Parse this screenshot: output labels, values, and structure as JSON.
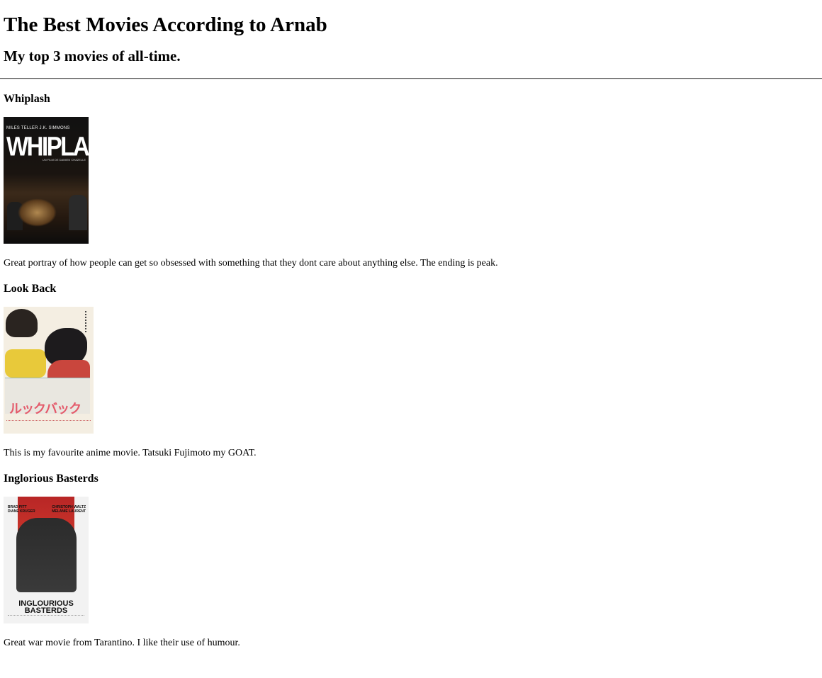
{
  "page": {
    "title": "The Best Movies According to Arnab",
    "subtitle": "My top 3 movies of all-time."
  },
  "movies": [
    {
      "title": "Whiplash",
      "review": "Great portray of how people can get so obsessed with something that they dont care about anything else. The ending is peak.",
      "poster": {
        "cast_text": "MILES TELLER  J.K. SIMMONS",
        "title_text": "WHIPLASH",
        "credit_text": "UN FILM DE DAMIEN CHAZELLE"
      }
    },
    {
      "title": "Look Back",
      "review": "This is my favourite anime movie. Tatsuki Fujimoto my GOAT.",
      "poster": {
        "title_text": "ルックバック"
      }
    },
    {
      "title": "Inglorious Basterds",
      "review": "Great war movie from Tarantino. I like their use of humour.",
      "poster": {
        "names_left": "BRAD PITT\nDIANE KRUGER",
        "names_right": "CHRISTOPH WALTZ\nMELANIE LAURENT",
        "title_text": "INGLOURIOUS BASTERDS"
      }
    }
  ]
}
